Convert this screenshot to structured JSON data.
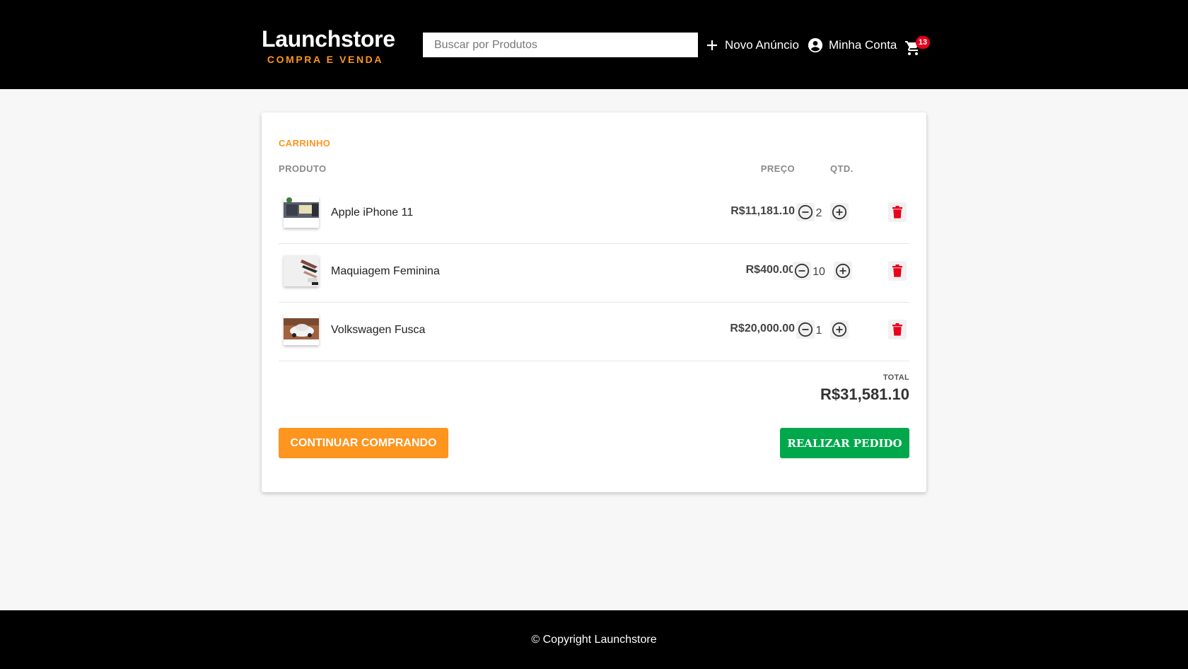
{
  "brand": {
    "title": "Launchstore",
    "subtitle": "COMPRA E VENDA",
    "accent": "#fd951f"
  },
  "search": {
    "placeholder": "Buscar por Produtos",
    "value": ""
  },
  "nav": {
    "new_ad": "Novo Anúncio",
    "account": "Minha Conta",
    "cart_count": "13"
  },
  "cart": {
    "title": "CARRINHO",
    "headers": {
      "product": "PRODUTO",
      "price": "PREÇO",
      "qty": "QTD."
    },
    "items": [
      {
        "name": "Apple iPhone 11",
        "price": "R$11,181.10",
        "qty": "2"
      },
      {
        "name": "Maquiagem Feminina",
        "price": "R$400.00",
        "qty": "10"
      },
      {
        "name": "Volkswagen Fusca",
        "price": "R$20,000.00",
        "qty": "1"
      }
    ],
    "total_label": "TOTAL",
    "total_value": "R$31,581.10",
    "continue_label": "CONTINUAR COMPRANDO",
    "order_label": "REALIZAR PEDIDO"
  },
  "footer": {
    "text": "© Copyright Launchstore"
  },
  "colors": {
    "header_bg": "#000000",
    "order_green": "#00a84b",
    "delete_red": "#e8001c",
    "badge_red": "#e8001c"
  }
}
